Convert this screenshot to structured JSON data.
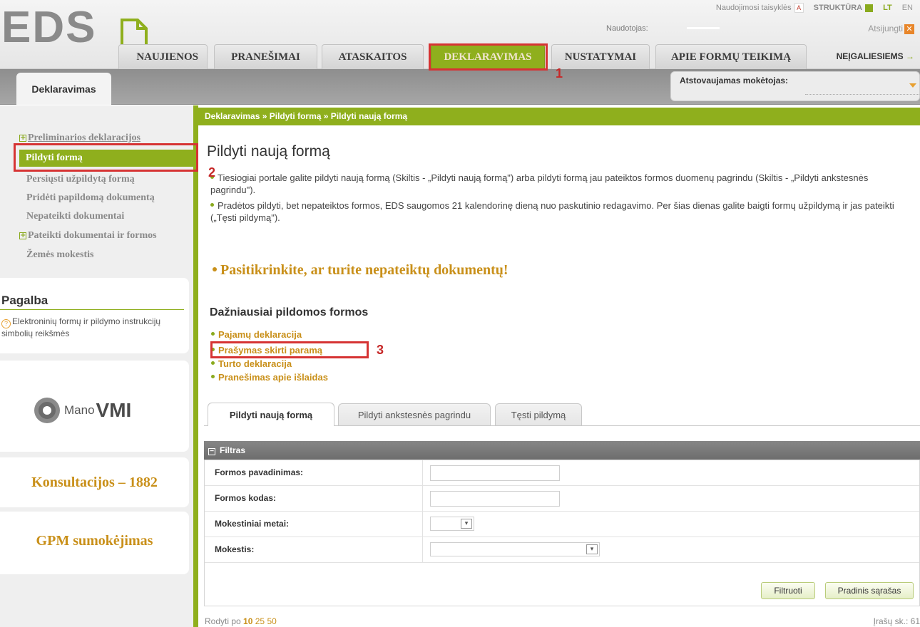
{
  "header": {
    "logo": "EDS",
    "util_rules": "Naudojimosi taisyklės",
    "util_structure": "STRUKTŪRA",
    "lang_lt": "LT",
    "lang_en": "EN",
    "user_label": "Naudotojas:",
    "logout": "Atsijungti",
    "accent_color": "#8faf1d"
  },
  "nav": {
    "tabs": [
      "NAUJIENOS",
      "PRANEŠIMAI",
      "ATASKAITOS",
      "DEKLARAVIMAS",
      "NUSTATYMAI",
      "APIE FORMŲ TEIKIMĄ"
    ],
    "active": "DEKLARAVIMAS",
    "disabled_link": "NEĮGALIESIEMS",
    "disabled_arrow": "→"
  },
  "subbar": {
    "subtab": "Deklaravimas",
    "represented_label": "Atstovaujamas mokėtojas:"
  },
  "sidebar": {
    "items": [
      {
        "label": "Preliminarios deklaracijos",
        "expandable": true
      },
      {
        "label": "Pildyti formą",
        "active": true
      },
      {
        "label": "Persiųsti užpildytą formą"
      },
      {
        "label": "Pridėti papildomą dokumentą"
      },
      {
        "label": "Nepateikti dokumentai"
      },
      {
        "label": "Pateikti dokumentai ir formos",
        "expandable": true
      },
      {
        "label": "Žemės mokestis"
      }
    ],
    "help_title": "Pagalba",
    "help_link": "Elektroninių formų ir pildymo instrukcijų simbolių reikšmės",
    "mano_small": "Mano",
    "mano_big": "VMI",
    "konsultacijos": "Konsultacijos – 1882",
    "gpm": "GPM sumokėjimas"
  },
  "main": {
    "breadcrumb": "Deklaravimas » Pildyti formą » Pildyti naują formą",
    "title": "Pildyti naują formą",
    "info1": "Tiesiogiai portale galite pildyti naują formą (Skiltis - „Pildyti naują formą\") arba pildyti formą jau pateiktos formos duomenų pagrindu (Skiltis - „Pildyti ankstesnės pagrindu\").",
    "info2": "Pradėtos pildyti, bet nepateiktos formos, EDS saugomos 21 kalendorinę dieną nuo paskutinio redagavimo. Per šias dienas galite baigti formų užpildymą ir jas pateikti („Tęsti pildymą\").",
    "check_link": "Pasitikrinkite, ar turite nepateiktų dokumentų!",
    "freq_title": "Dažniausiai pildomos formos",
    "freq_items": [
      "Pajamų deklaracija",
      "Prašymas skirti paramą",
      "Turto deklaracija",
      "Pranešimas apie išlaidas"
    ],
    "form_tabs": [
      "Pildyti naują formą",
      "Pildyti ankstesnės pagrindu",
      "Tęsti pildymą"
    ],
    "filter_title": "Filtras",
    "filter_fields": [
      {
        "label": "Formos pavadinimas:",
        "value": ""
      },
      {
        "label": "Formos kodas:",
        "value": ""
      },
      {
        "label": "Mokestiniai metai:",
        "value": ""
      },
      {
        "label": "Mokestis:",
        "value": ""
      }
    ],
    "btn_filter": "Filtruoti",
    "btn_reset": "Pradinis sąrašas",
    "show_prefix": "Rodyti po",
    "show_options": [
      "10",
      "25",
      "50"
    ],
    "records": "Įrašų sk.: 61"
  },
  "annotations": {
    "numbers": [
      "1",
      "2",
      "3"
    ],
    "color": "#d63333"
  }
}
